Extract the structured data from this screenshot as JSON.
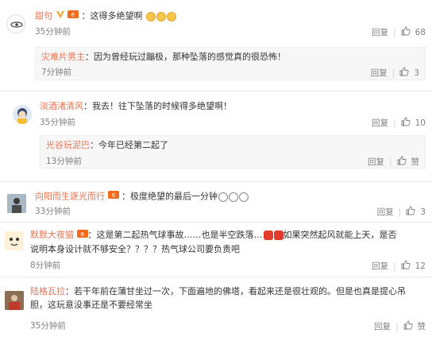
{
  "comments": [
    {
      "username": "甜句",
      "text": "：这得多绝望啊",
      "time": "35分钟前",
      "reply_label": "回复",
      "likes": "68",
      "reply": {
        "username": "灾难片男主",
        "text": "：因为曾经玩过蹦极，那种坠落的感觉真的很恐怖！",
        "time": "7分钟前",
        "reply_label": "回复",
        "likes": "3"
      }
    },
    {
      "username": "淡酒渚清风",
      "text": "：我去！往下坠落的时候得多绝望啊！",
      "time": "35分钟前",
      "reply_label": "回复",
      "likes": "10",
      "reply": {
        "username": "光谷玩泥巴",
        "text": "：今年已经第二起了",
        "time": "13分钟前",
        "reply_label": "回复",
        "likes": "赞"
      }
    },
    {
      "username": "向阳而生逐光而行",
      "text": "：极度绝望的最后一分钟",
      "time": "33分钟前",
      "reply_label": "回复",
      "likes": "3"
    },
    {
      "username": "默默大夜猫",
      "text_a": "：这是第二起热气球事故……也是半空跌落…",
      "text_b": "如果突然起风就能上天，是否",
      "text_c": "说明本身设计就不够安全？？？？热气球公司要负责吧",
      "time": "8分钟前",
      "reply_label": "回复",
      "likes": "12"
    },
    {
      "username": "陆格瓦拉",
      "text_a": "：若干年前在蒲甘坐过一次，下面遍地的佛塔，看起来还是很壮观的。但是也真是提心吊",
      "text_b": "胆，这玩意没事还是不要经常坐",
      "time": "35分钟前",
      "reply_label": "回复",
      "likes": "赞"
    }
  ],
  "colors": {
    "username": "#eb7350",
    "meta": "#808080",
    "reply_bg": "#f7f7f7"
  }
}
